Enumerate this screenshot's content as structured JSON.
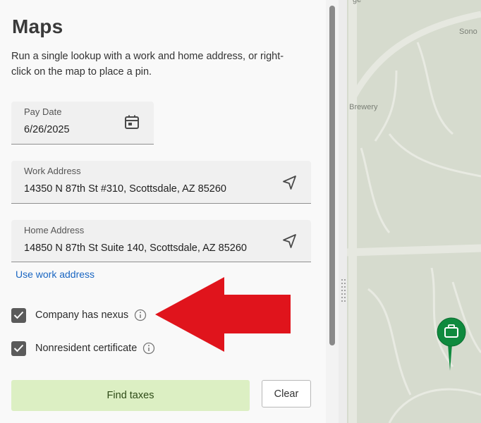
{
  "panel": {
    "title": "Maps",
    "description": "Run a single lookup with a work and home address, or right-click on the map to place a pin."
  },
  "form": {
    "pay_date": {
      "label": "Pay Date",
      "value": "6/26/2025"
    },
    "work_address": {
      "label": "Work Address",
      "value": "14350 N 87th St #310, Scottsdale, AZ 85260"
    },
    "home_address": {
      "label": "Home Address",
      "value": "14850 N 87th St Suite 140, Scottsdale, AZ 85260"
    },
    "use_work_link": "Use work address",
    "company_nexus": {
      "label": "Company has nexus",
      "checked": true
    },
    "nonresident": {
      "label": "Nonresident certificate",
      "checked": true
    },
    "find_button": "Find taxes",
    "clear_button": "Clear"
  },
  "map": {
    "labels": [
      "ge",
      "Sono",
      "n Brewery"
    ],
    "pin_icon": "briefcase-icon",
    "pin_color": "#0f8a3e"
  },
  "colors": {
    "accent_link": "#1a66c2",
    "find_button_bg": "#dcefc3",
    "arrow": "#e0141c"
  }
}
